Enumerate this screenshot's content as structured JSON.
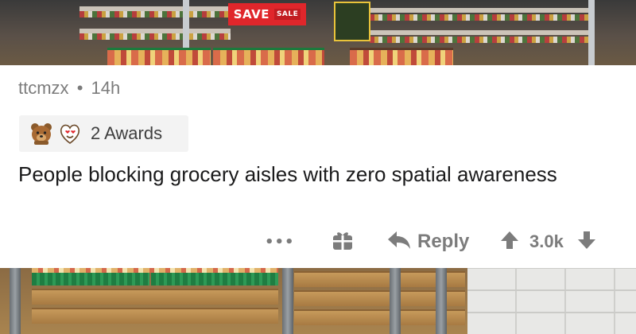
{
  "photo": {
    "sign_main": "SAVE",
    "sign_small": "SALE"
  },
  "comment": {
    "username": "ttcmzx",
    "separator": "•",
    "age": "14h",
    "awards_label": "2 Awards",
    "award_icons": [
      "bear-award-icon",
      "heart-eyes-award-icon"
    ],
    "body": "People blocking grocery aisles with zero spatial awareness",
    "actions": {
      "more": "•••",
      "reply_label": "Reply",
      "score": "3.0k"
    }
  },
  "colors": {
    "meta_gray": "#7c7c7c",
    "text": "#1a1a1b",
    "award_bg": "#f3f3f3",
    "save_red": "#e0262b"
  }
}
